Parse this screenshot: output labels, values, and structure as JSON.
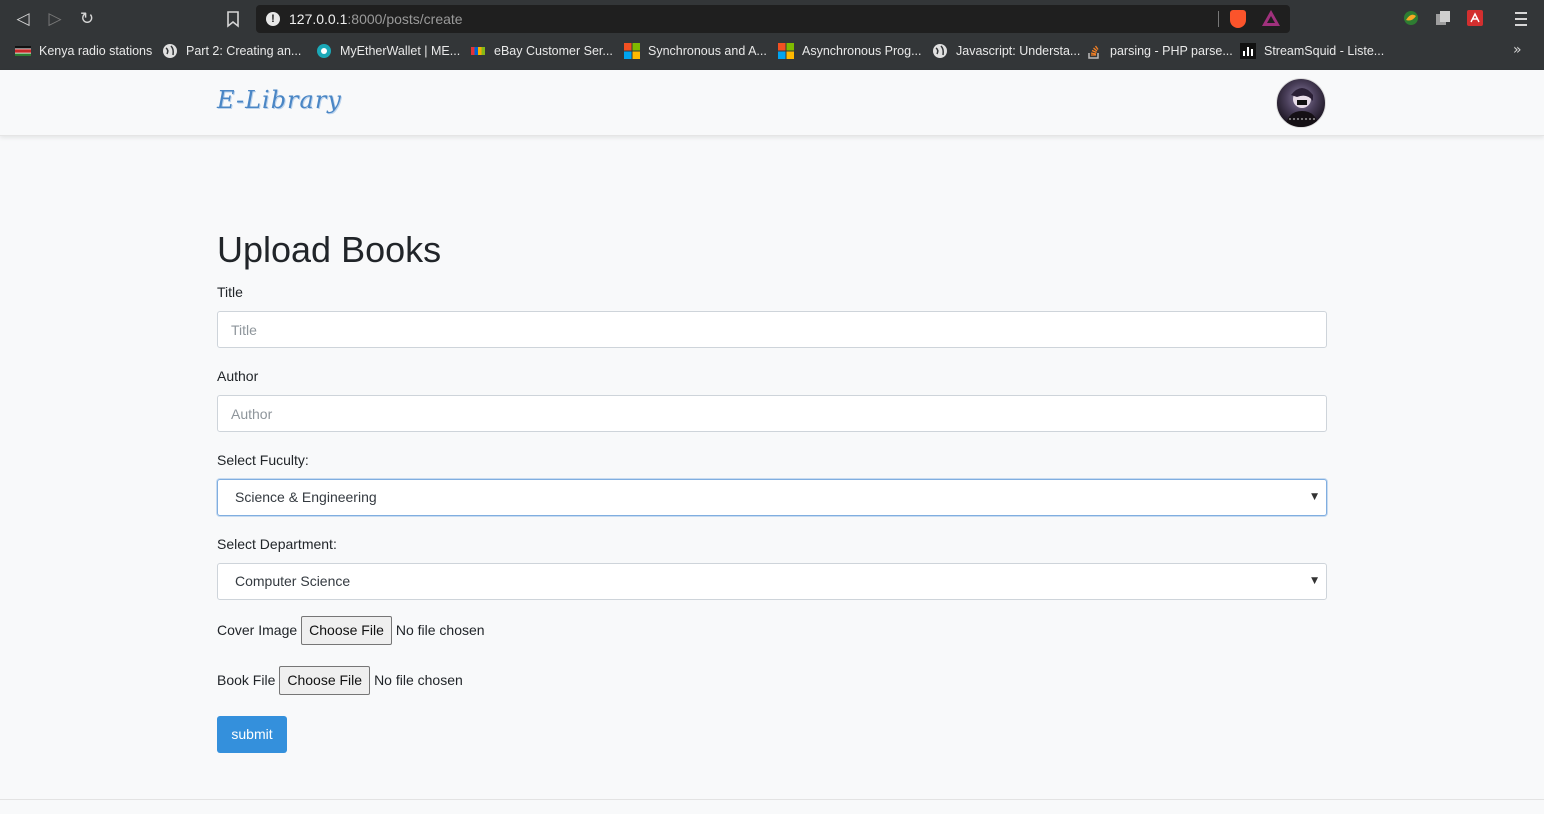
{
  "browser": {
    "url_host": "127.0.0.1",
    "url_path": ":8000/posts/create",
    "bookmarks": [
      {
        "label": "Kenya radio stations",
        "icon": "kenya-flag-icon"
      },
      {
        "label": "Part 2: Creating an...",
        "icon": "globe-icon"
      },
      {
        "label": "MyEtherWallet | ME...",
        "icon": "mew-icon"
      },
      {
        "label": "eBay Customer Ser...",
        "icon": "ebay-icon"
      },
      {
        "label": "Synchronous and A...",
        "icon": "microsoft-icon"
      },
      {
        "label": "Asynchronous Prog...",
        "icon": "microsoft-icon"
      },
      {
        "label": "Javascript: Understa...",
        "icon": "globe-icon"
      },
      {
        "label": "parsing - PHP parse...",
        "icon": "stackoverflow-icon"
      },
      {
        "label": "StreamSquid - Liste...",
        "icon": "streamsquid-icon"
      }
    ],
    "more_glyph": "»"
  },
  "navbar": {
    "brand": "E-Library"
  },
  "form": {
    "heading": "Upload Books",
    "title_label": "Title",
    "title_placeholder": "Title",
    "author_label": "Author",
    "author_placeholder": "Author",
    "faculty_label": "Select Fuculty:",
    "faculty_value": "Science & Engineering",
    "department_label": "Select Department:",
    "department_value": "Computer Science",
    "cover_label": "Cover Image",
    "cover_button": "Choose File",
    "cover_status": "No file chosen",
    "book_label": "Book File",
    "book_button": "Choose File",
    "book_status": "No file chosen",
    "submit_label": "submit"
  },
  "colors": {
    "accent": "#3490dc",
    "brand": "#4a86c5",
    "chrome": "#333638"
  }
}
